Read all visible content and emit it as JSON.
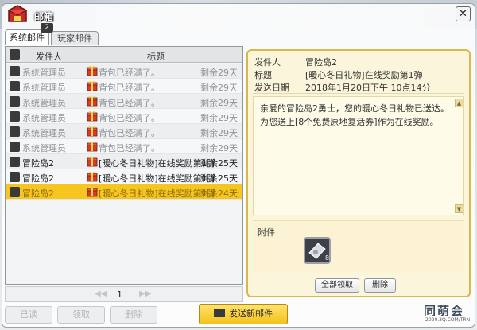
{
  "window": {
    "title": "邮箱",
    "close_glyph": "✕"
  },
  "tabs": [
    {
      "label": "系统邮件",
      "badge": "2",
      "active": true
    },
    {
      "label": "玩家邮件",
      "active": false
    }
  ],
  "list": {
    "headers": {
      "sender": "发件人",
      "subject": "标题"
    },
    "rows": [
      {
        "sender": "系统管理员",
        "subject": "背包已经满了。",
        "days": "剩余29天",
        "state": "read"
      },
      {
        "sender": "系统管理员",
        "subject": "背包已经满了。",
        "days": "剩余29天",
        "state": "read"
      },
      {
        "sender": "系统管理员",
        "subject": "背包已经满了。",
        "days": "剩余29天",
        "state": "read"
      },
      {
        "sender": "系统管理员",
        "subject": "背包已经满了。",
        "days": "剩余29天",
        "state": "read"
      },
      {
        "sender": "系统管理员",
        "subject": "背包已经满了。",
        "days": "剩余29天",
        "state": "read"
      },
      {
        "sender": "系统管理员",
        "subject": "背包已经满了。",
        "days": "剩余29天",
        "state": "read"
      },
      {
        "sender": "冒险岛2",
        "subject": "[暖心冬日礼物]在线奖励第1弹",
        "days": "剩余25天",
        "state": "unread"
      },
      {
        "sender": "冒险岛2",
        "subject": "[暖心冬日礼物]在线奖励第1弹",
        "days": "剩余25天",
        "state": "unread"
      },
      {
        "sender": "冒险岛2",
        "subject": "[暖心冬日礼物]在线奖励第1弹",
        "days": "剩余24天",
        "state": "selected"
      }
    ]
  },
  "pager": {
    "prev": "◀◀",
    "page": "1",
    "next": "▶▶"
  },
  "detail": {
    "sender_label": "发件人",
    "sender": "冒险岛2",
    "subject_label": "标题",
    "subject": "[暖心冬日礼物]在线奖励第1弹",
    "date_label": "发送日期",
    "date": "2018年1月20日下午 10点14分",
    "body_lines": [
      "亲爱的冒险岛2勇士，您的暖心冬日礼物已送达。",
      "为您送上[8个免费原地复活券]作为在线奖励。"
    ],
    "attach_label": "附件",
    "attach_count": "8",
    "claim_all": "全部领取",
    "delete": "删除"
  },
  "bottom": {
    "read": "已读",
    "claim": "领取",
    "delete": "删除",
    "send": "发送新邮件"
  },
  "logo": {
    "main": "同萌会",
    "sub": "2020.3Q.COM/TRN"
  },
  "colors": {
    "selected_row": "#f6c51f",
    "detail_border": "#d8b84a",
    "gift_red": "#d93a2b"
  }
}
